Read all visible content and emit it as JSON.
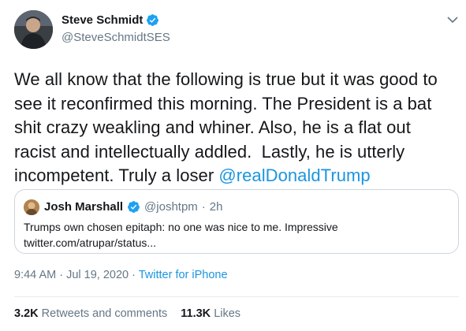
{
  "author": {
    "name": "Steve Schmidt",
    "handle": "@SteveSchmidtSES"
  },
  "tweet": {
    "text_before": "We all know that the following is true but it was good to see it reconfirmed this morning. The President is a bat shit crazy weakling and whiner. Also, he is a flat out racist and intellectually addled.  Lastly, he is utterly incompetent. Truly a loser ",
    "mention": "@realDonaldTrump"
  },
  "quoted_tweet": {
    "name": "Josh Marshall",
    "handle": "@joshtpm",
    "separator": "·",
    "time": "2h",
    "text": "Trumps own chosen epitaph: no one was nice to me. Impressive\ntwitter.com/atrupar/status..."
  },
  "meta": {
    "timestamp": "9:44 AM · Jul 19, 2020 · ",
    "source": "Twitter for iPhone"
  },
  "stats": {
    "retweets_count": "3.2K",
    "retweets_label": "Retweets and comments",
    "likes_count": "11.3K",
    "likes_label": "Likes"
  },
  "colors": {
    "link": "#1b95e0",
    "verified": "#1da1f2",
    "muted": "#657786",
    "border": "#ccd6dd"
  },
  "icons": [
    "verified-badge-icon",
    "chevron-down-icon"
  ]
}
